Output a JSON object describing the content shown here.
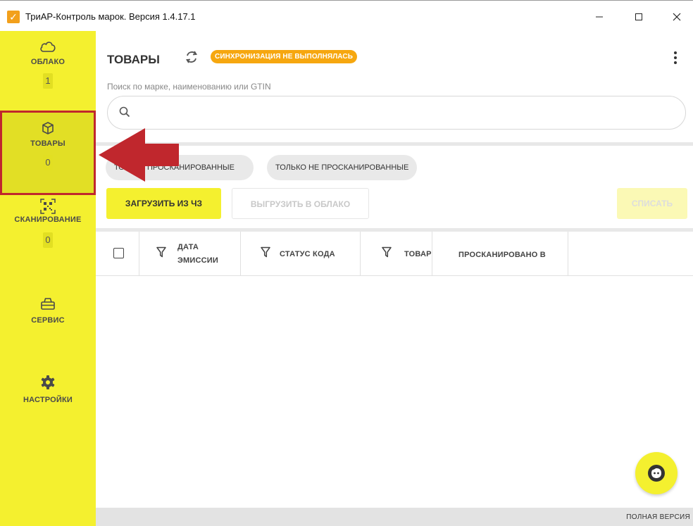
{
  "window": {
    "title": "ТриАР-Контроль марок. Версия 1.4.17.1"
  },
  "sidebar": {
    "items": [
      {
        "label": "ОБЛАКО",
        "badge": "1",
        "icon": "cloud-icon"
      },
      {
        "label": "ТОВАРЫ",
        "badge": "0",
        "icon": "box-icon",
        "active": true
      },
      {
        "label": "СКАНИРОВАНИЕ",
        "badge": "0",
        "icon": "qr-code-icon"
      },
      {
        "label": "СЕРВИС",
        "icon": "toolbox-icon"
      },
      {
        "label": "НАСТРОЙКИ",
        "icon": "gear-icon"
      }
    ]
  },
  "main": {
    "title": "ТОВАРЫ",
    "sync_status": "СИНХРОНИЗАЦИЯ НЕ ВЫПОЛНЯЛАСЬ",
    "search": {
      "label": "Поиск по марке, наименованию или GTIN",
      "value": ""
    },
    "filters": [
      {
        "label": "ТОЛЬКО ПРОСКАНИРОВАННЫЕ"
      },
      {
        "label": "ТОЛЬКО НЕ ПРОСКАНИРОВАННЫЕ"
      }
    ],
    "actions": {
      "load": "ЗАГРУЗИТЬ ИЗ ЧЗ",
      "upload": "ВЫГРУЗИТЬ В ОБЛАКО",
      "write_off": "СПИСАТЬ"
    },
    "table": {
      "columns": [
        {
          "label_line1": "ДАТА",
          "label_line2": "ЭМИССИИ"
        },
        {
          "label": "СТАТУС КОДА"
        },
        {
          "label": "ТОВАР"
        },
        {
          "label": "ПРОСКАНИРОВАНО В"
        }
      ],
      "rows": []
    },
    "footer": "ПОЛНАЯ ВЕРСИЯ"
  },
  "colors": {
    "sidebar": "#f4f02f",
    "accent_orange": "#f6a70f",
    "highlight_red": "#c0272d"
  }
}
